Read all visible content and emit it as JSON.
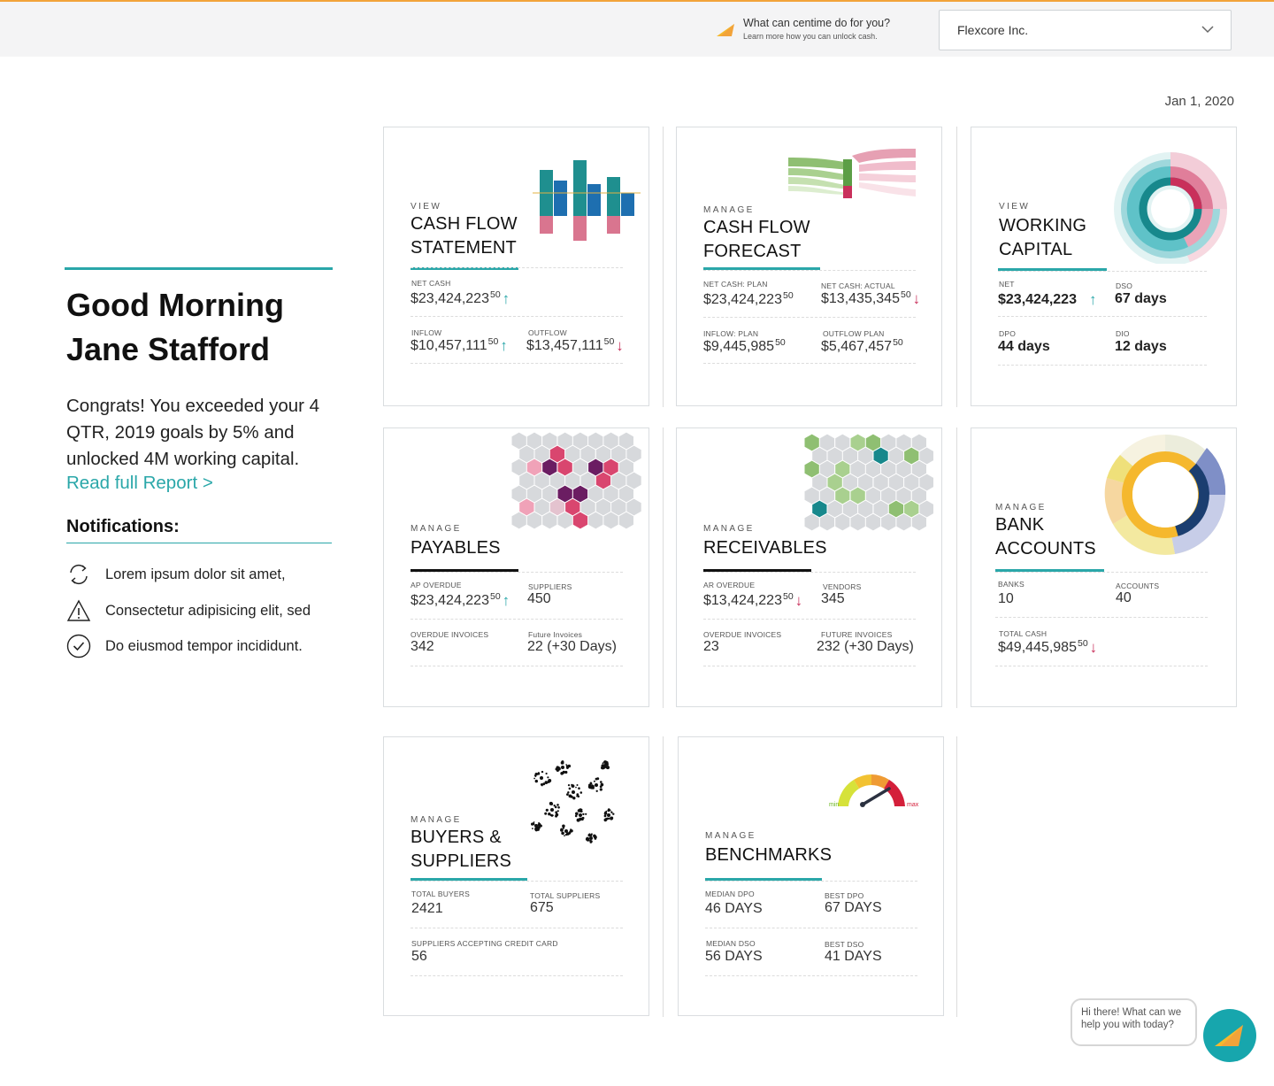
{
  "header": {
    "promo_title": "What can centime do for you?",
    "promo_sub": "Learn more how you can unlock cash.",
    "company_selected": "Flexcore Inc.",
    "accent": "#f2a33a"
  },
  "date": "Jan 1, 2020",
  "greeting": {
    "line1": "Good Morning",
    "line2": "Jane Stafford",
    "message": "Congrats! You exceeded your 4 QTR, 2019 goals by 5% and unlocked 4M working capital.",
    "link": "Read full Report >"
  },
  "notifications": {
    "title": "Notifications:",
    "items": [
      {
        "icon": "sync-icon",
        "text": "Lorem ipsum dolor sit amet,"
      },
      {
        "icon": "warning-icon",
        "text": "Consectetur adipisicing elit, sed"
      },
      {
        "icon": "check-circle-icon",
        "text": "Do eiusmod tempor incididunt."
      }
    ]
  },
  "cards": {
    "cash_flow_statement": {
      "eyebrow": "VIEW",
      "title1": "CASH FLOW",
      "title2": "STATEMENT",
      "l1": "NET CASH",
      "v1": "$23,424,223",
      "s1": "50",
      "l2": "INFLOW",
      "v2": "$10,457,111",
      "s2": "50",
      "l3": "OUTFLOW",
      "v3": "$13,457,111",
      "s3": "50"
    },
    "cash_flow_forecast": {
      "eyebrow": "MANAGE",
      "title1": "CASH FLOW",
      "title2": "FORECAST",
      "l1": "NET CASH: PLAN",
      "v1": "$23,424,223",
      "s1": "50",
      "l2": "NET CASH: ACTUAL",
      "v2": "$13,435,345",
      "s2": "50",
      "l3": "INFLOW: PLAN",
      "v3": "$9,445,985",
      "s3": "50",
      "l4": "OUTFLOW PLAN",
      "v4": "$5,467,457",
      "s4": "50"
    },
    "working_capital": {
      "eyebrow": "VIEW",
      "title1": "WORKING",
      "title2": "CAPITAL",
      "l1": "NET",
      "v1": "$23,424,223",
      "l2": "DSO",
      "v2": "67 days",
      "l3": "DPO",
      "v3": "44 days",
      "l4": "DIO",
      "v4": "12 days"
    },
    "payables": {
      "eyebrow": "MANAGE",
      "title1": "PAYABLES",
      "l1": "AP OVERDUE",
      "v1": "$23,424,223",
      "s1": "50",
      "l2": "SUPPLIERS",
      "v2": "450",
      "l3": "OVERDUE INVOICES",
      "v3": "342",
      "l4": "Future Invoices",
      "v4": "22 (+30 Days)"
    },
    "receivables": {
      "eyebrow": "MANAGE",
      "title1": "RECEIVABLES",
      "l1": "AR OVERDUE",
      "v1": "$13,424,223",
      "s1": "50",
      "l2": "VENDORS",
      "v2": "345",
      "l3": "OVERDUE INVOICES",
      "v3": "23",
      "l4": "FUTURE INVOICES",
      "v4": "232 (+30 Days)"
    },
    "bank_accounts": {
      "eyebrow": "MANAGE",
      "title1": "BANK",
      "title2": "ACCOUNTS",
      "l1": "BANKS",
      "v1": "10",
      "l2": "ACCOUNTS",
      "v2": "40",
      "l3": "TOTAL CASH",
      "v3": "$49,445,985",
      "s3": "50"
    },
    "buyers_suppliers": {
      "eyebrow": "MANAGE",
      "title1": "BUYERS &",
      "title2": "SUPPLIERS",
      "l1": "TOTAL BUYERS",
      "v1": "2421",
      "l2": "TOTAL SUPPLIERS",
      "v2": "675",
      "l3": "SUPPLIERS ACCEPTING CREDIT CARD",
      "v3": "56"
    },
    "benchmarks": {
      "eyebrow": "MANAGE",
      "title1": "BENCHMARKS",
      "l1": "MEDIAN DPO",
      "v1": "46 DAYS",
      "l2": "BEST DPO",
      "v2": "67 DAYS",
      "l3": "MEDIAN DSO",
      "v3": "56 DAYS",
      "l4": "BEST DSO",
      "v4": "41 DAYS",
      "gauge_min": "min",
      "gauge_max": "max"
    }
  },
  "chat": {
    "bubble": "Hi there! What can we help you with today?"
  },
  "colors": {
    "teal": "#2aa7a9",
    "pink": "#c9305b",
    "dark": "#111111"
  }
}
